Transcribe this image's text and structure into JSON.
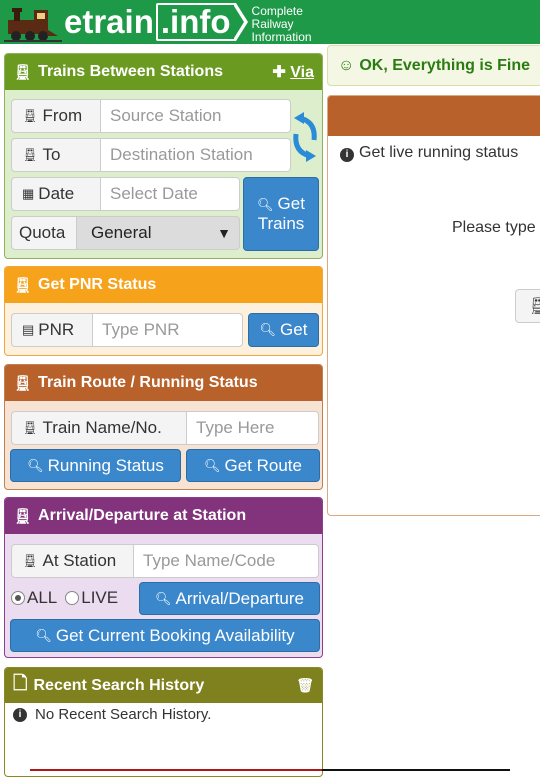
{
  "header": {
    "logo_brand": "etrain",
    "logo_tld": ".info",
    "tagline_1": "Complete",
    "tagline_2": "Railway",
    "tagline_3": "Information"
  },
  "trains_between": {
    "title": "Trains Between Stations",
    "via_link": "Via",
    "from_label": "From",
    "from_placeholder": "Source Station",
    "to_label": "To",
    "to_placeholder": "Destination Station",
    "date_label": "Date",
    "date_placeholder": "Select Date",
    "quota_label": "Quota",
    "quota_value": "General",
    "get_trains_line1": "Get",
    "get_trains_line2": "Trains"
  },
  "pnr": {
    "title": "Get PNR Status",
    "label": "PNR",
    "placeholder": "Type PNR",
    "button": "Get"
  },
  "route": {
    "title": "Train Route / Running Status",
    "label": "Train Name/No.",
    "placeholder": "Type Here",
    "running_button": "Running Status",
    "route_button": "Get Route"
  },
  "arrival": {
    "title": "Arrival/Departure at Station",
    "label": "At Station",
    "placeholder": "Type Name/Code",
    "radio_all": "ALL",
    "radio_live": "LIVE",
    "arrival_button": "Arrival/Departure",
    "booking_button": "Get Current Booking Availability"
  },
  "history": {
    "title": "Recent Search History",
    "empty_text": "No Recent Search History."
  },
  "status": {
    "text": "OK, Everything is Fine"
  },
  "right_panel": {
    "info_text": "Get live running status",
    "type_text": "Please type"
  },
  "colors": {
    "header_green": "#1e9948",
    "trains_green": "#6b9a21",
    "pnr_orange": "#f7a21b",
    "route_brown": "#b8612a",
    "arrival_purple": "#82337c",
    "history_olive": "#7f811f",
    "button_blue": "#3a87cc"
  }
}
